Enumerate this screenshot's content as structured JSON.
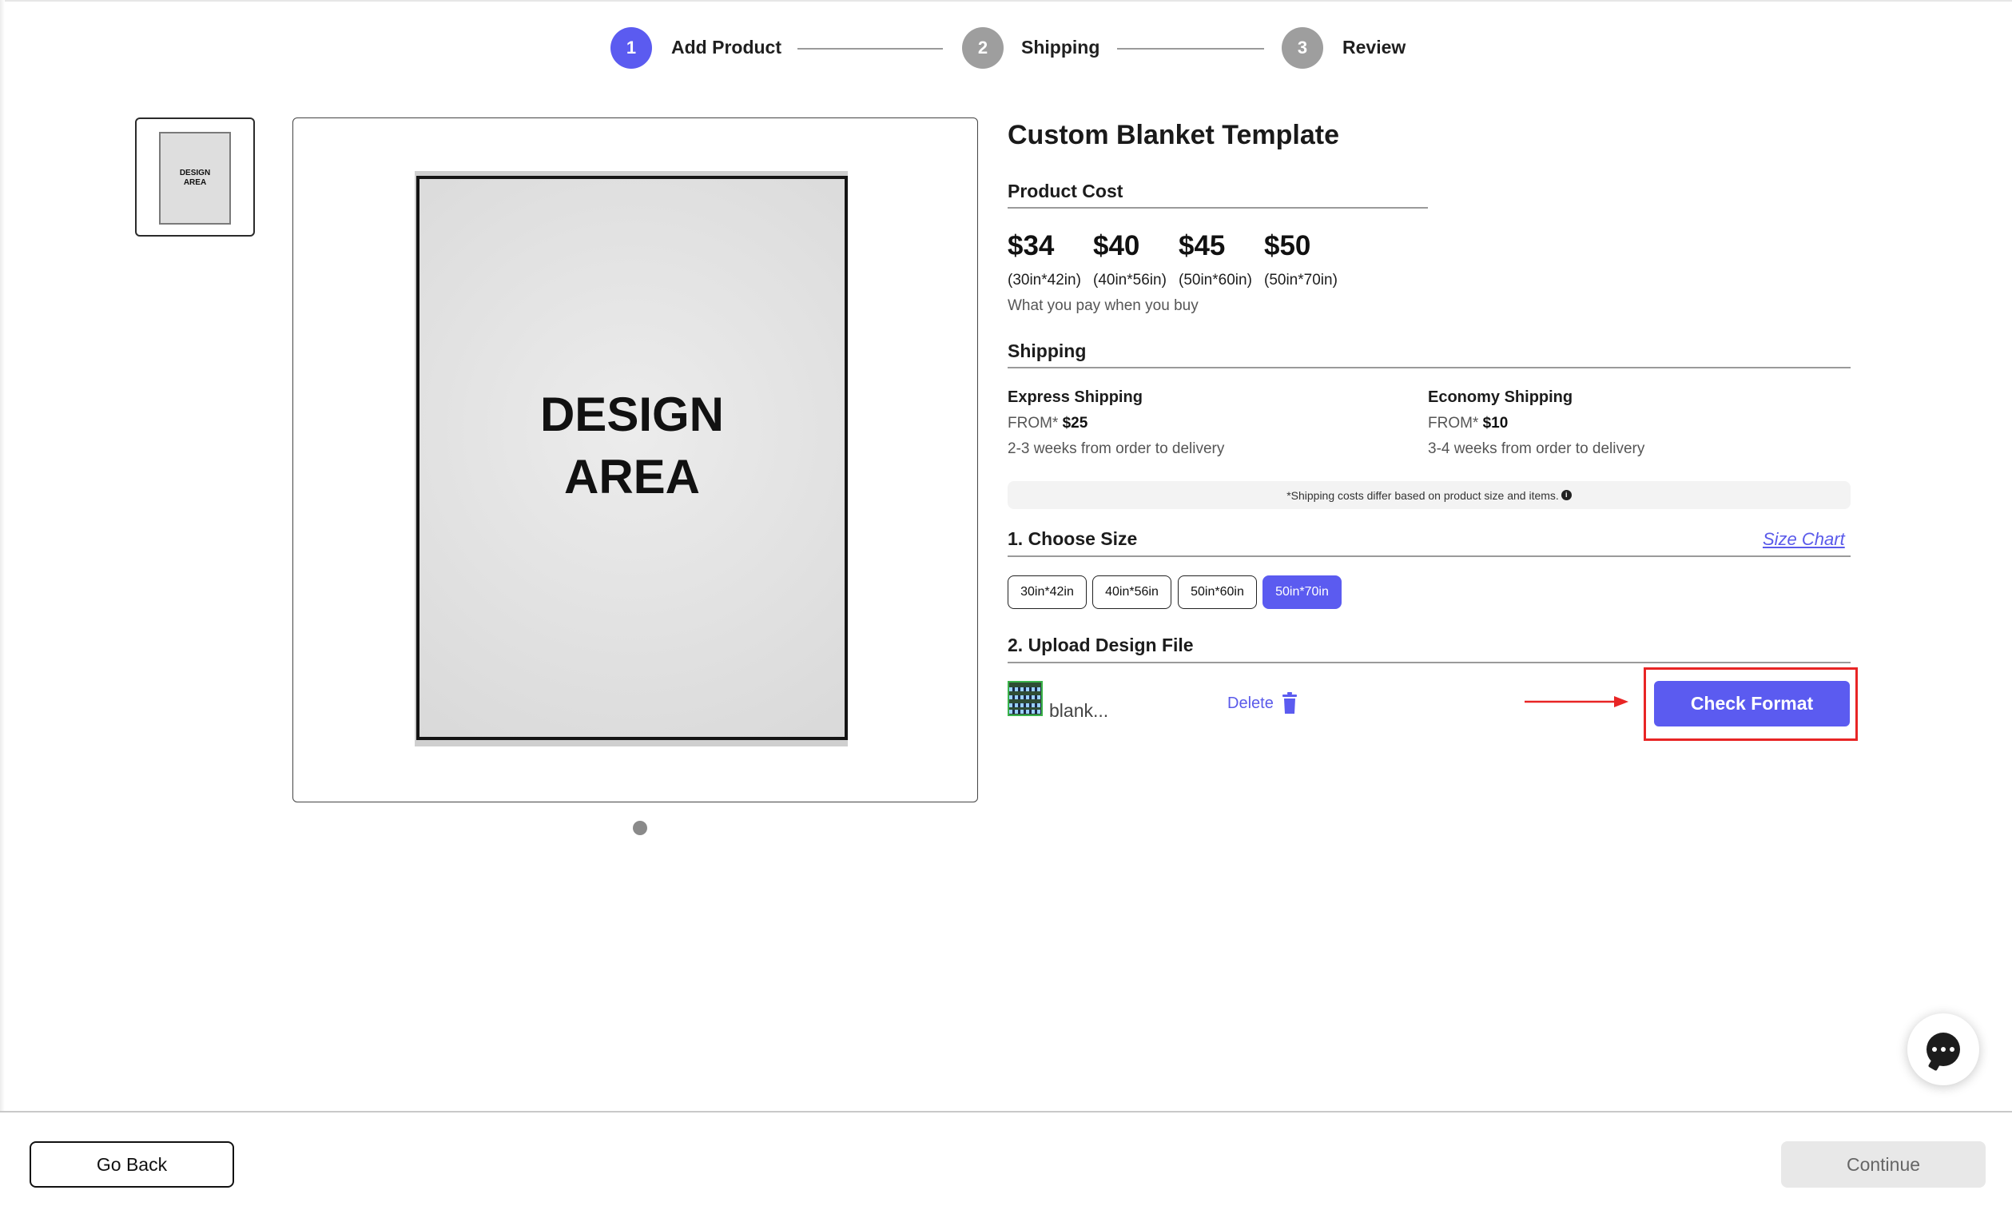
{
  "stepper": {
    "steps": [
      {
        "number": "1",
        "label": "Add Product",
        "state": "active"
      },
      {
        "number": "2",
        "label": "Shipping",
        "state": "inactive"
      },
      {
        "number": "3",
        "label": "Review",
        "state": "inactive"
      }
    ]
  },
  "preview": {
    "thumbnail_text": "DESIGN\nAREA",
    "canvas_text": "DESIGN\nAREA"
  },
  "product": {
    "title": "Custom Blanket Template",
    "cost_label": "Product Cost",
    "prices": [
      {
        "price": "$34",
        "size": "(30in*42in)"
      },
      {
        "price": "$40",
        "size": "(40in*56in)"
      },
      {
        "price": "$45",
        "size": "(50in*60in)"
      },
      {
        "price": "$50",
        "size": "(50in*70in)"
      }
    ],
    "pay_note": "What you pay when you buy"
  },
  "shipping": {
    "label": "Shipping",
    "options": [
      {
        "title": "Express Shipping",
        "from_prefix": "FROM*",
        "from_price": "$25",
        "time": "2-3 weeks from order to delivery"
      },
      {
        "title": "Economy Shipping",
        "from_prefix": "FROM*",
        "from_price": "$10",
        "time": "3-4 weeks from order to delivery"
      }
    ],
    "notice": "*Shipping costs differ based on product size and items."
  },
  "choose_size": {
    "label": "1. Choose Size",
    "size_chart_link": "Size Chart",
    "sizes": [
      "30in*42in",
      "40in*56in",
      "50in*60in",
      "50in*70in"
    ],
    "selected": "50in*70in"
  },
  "upload": {
    "label": "2. Upload Design File",
    "file_name": "blank...",
    "delete_label": "Delete",
    "check_button": "Check Format"
  },
  "footer": {
    "go_back": "Go Back",
    "continue": "Continue"
  },
  "colors": {
    "accent": "#5b5bf0",
    "highlight": "#e82525",
    "inactive_step": "#9e9e9e",
    "disabled_button": "#e8e8e8"
  },
  "icons": [
    "trash-icon",
    "info-icon",
    "arrow-right-icon",
    "chat-icon"
  ]
}
